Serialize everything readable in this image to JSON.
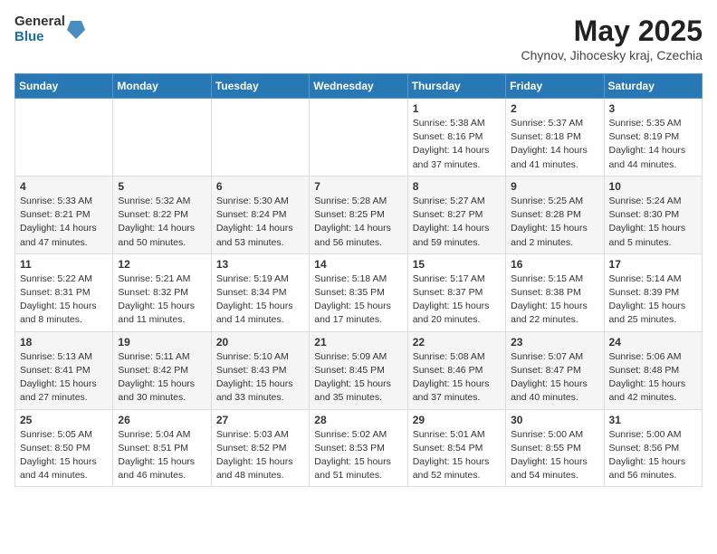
{
  "header": {
    "logo_general": "General",
    "logo_blue": "Blue",
    "month_title": "May 2025",
    "subtitle": "Chynov, Jihocesky kraj, Czechia"
  },
  "days_of_week": [
    "Sunday",
    "Monday",
    "Tuesday",
    "Wednesday",
    "Thursday",
    "Friday",
    "Saturday"
  ],
  "weeks": [
    [
      {
        "day": "",
        "info": ""
      },
      {
        "day": "",
        "info": ""
      },
      {
        "day": "",
        "info": ""
      },
      {
        "day": "",
        "info": ""
      },
      {
        "day": "1",
        "info": "Sunrise: 5:38 AM\nSunset: 8:16 PM\nDaylight: 14 hours\nand 37 minutes."
      },
      {
        "day": "2",
        "info": "Sunrise: 5:37 AM\nSunset: 8:18 PM\nDaylight: 14 hours\nand 41 minutes."
      },
      {
        "day": "3",
        "info": "Sunrise: 5:35 AM\nSunset: 8:19 PM\nDaylight: 14 hours\nand 44 minutes."
      }
    ],
    [
      {
        "day": "4",
        "info": "Sunrise: 5:33 AM\nSunset: 8:21 PM\nDaylight: 14 hours\nand 47 minutes."
      },
      {
        "day": "5",
        "info": "Sunrise: 5:32 AM\nSunset: 8:22 PM\nDaylight: 14 hours\nand 50 minutes."
      },
      {
        "day": "6",
        "info": "Sunrise: 5:30 AM\nSunset: 8:24 PM\nDaylight: 14 hours\nand 53 minutes."
      },
      {
        "day": "7",
        "info": "Sunrise: 5:28 AM\nSunset: 8:25 PM\nDaylight: 14 hours\nand 56 minutes."
      },
      {
        "day": "8",
        "info": "Sunrise: 5:27 AM\nSunset: 8:27 PM\nDaylight: 14 hours\nand 59 minutes."
      },
      {
        "day": "9",
        "info": "Sunrise: 5:25 AM\nSunset: 8:28 PM\nDaylight: 15 hours\nand 2 minutes."
      },
      {
        "day": "10",
        "info": "Sunrise: 5:24 AM\nSunset: 8:30 PM\nDaylight: 15 hours\nand 5 minutes."
      }
    ],
    [
      {
        "day": "11",
        "info": "Sunrise: 5:22 AM\nSunset: 8:31 PM\nDaylight: 15 hours\nand 8 minutes."
      },
      {
        "day": "12",
        "info": "Sunrise: 5:21 AM\nSunset: 8:32 PM\nDaylight: 15 hours\nand 11 minutes."
      },
      {
        "day": "13",
        "info": "Sunrise: 5:19 AM\nSunset: 8:34 PM\nDaylight: 15 hours\nand 14 minutes."
      },
      {
        "day": "14",
        "info": "Sunrise: 5:18 AM\nSunset: 8:35 PM\nDaylight: 15 hours\nand 17 minutes."
      },
      {
        "day": "15",
        "info": "Sunrise: 5:17 AM\nSunset: 8:37 PM\nDaylight: 15 hours\nand 20 minutes."
      },
      {
        "day": "16",
        "info": "Sunrise: 5:15 AM\nSunset: 8:38 PM\nDaylight: 15 hours\nand 22 minutes."
      },
      {
        "day": "17",
        "info": "Sunrise: 5:14 AM\nSunset: 8:39 PM\nDaylight: 15 hours\nand 25 minutes."
      }
    ],
    [
      {
        "day": "18",
        "info": "Sunrise: 5:13 AM\nSunset: 8:41 PM\nDaylight: 15 hours\nand 27 minutes."
      },
      {
        "day": "19",
        "info": "Sunrise: 5:11 AM\nSunset: 8:42 PM\nDaylight: 15 hours\nand 30 minutes."
      },
      {
        "day": "20",
        "info": "Sunrise: 5:10 AM\nSunset: 8:43 PM\nDaylight: 15 hours\nand 33 minutes."
      },
      {
        "day": "21",
        "info": "Sunrise: 5:09 AM\nSunset: 8:45 PM\nDaylight: 15 hours\nand 35 minutes."
      },
      {
        "day": "22",
        "info": "Sunrise: 5:08 AM\nSunset: 8:46 PM\nDaylight: 15 hours\nand 37 minutes."
      },
      {
        "day": "23",
        "info": "Sunrise: 5:07 AM\nSunset: 8:47 PM\nDaylight: 15 hours\nand 40 minutes."
      },
      {
        "day": "24",
        "info": "Sunrise: 5:06 AM\nSunset: 8:48 PM\nDaylight: 15 hours\nand 42 minutes."
      }
    ],
    [
      {
        "day": "25",
        "info": "Sunrise: 5:05 AM\nSunset: 8:50 PM\nDaylight: 15 hours\nand 44 minutes."
      },
      {
        "day": "26",
        "info": "Sunrise: 5:04 AM\nSunset: 8:51 PM\nDaylight: 15 hours\nand 46 minutes."
      },
      {
        "day": "27",
        "info": "Sunrise: 5:03 AM\nSunset: 8:52 PM\nDaylight: 15 hours\nand 48 minutes."
      },
      {
        "day": "28",
        "info": "Sunrise: 5:02 AM\nSunset: 8:53 PM\nDaylight: 15 hours\nand 51 minutes."
      },
      {
        "day": "29",
        "info": "Sunrise: 5:01 AM\nSunset: 8:54 PM\nDaylight: 15 hours\nand 52 minutes."
      },
      {
        "day": "30",
        "info": "Sunrise: 5:00 AM\nSunset: 8:55 PM\nDaylight: 15 hours\nand 54 minutes."
      },
      {
        "day": "31",
        "info": "Sunrise: 5:00 AM\nSunset: 8:56 PM\nDaylight: 15 hours\nand 56 minutes."
      }
    ]
  ]
}
